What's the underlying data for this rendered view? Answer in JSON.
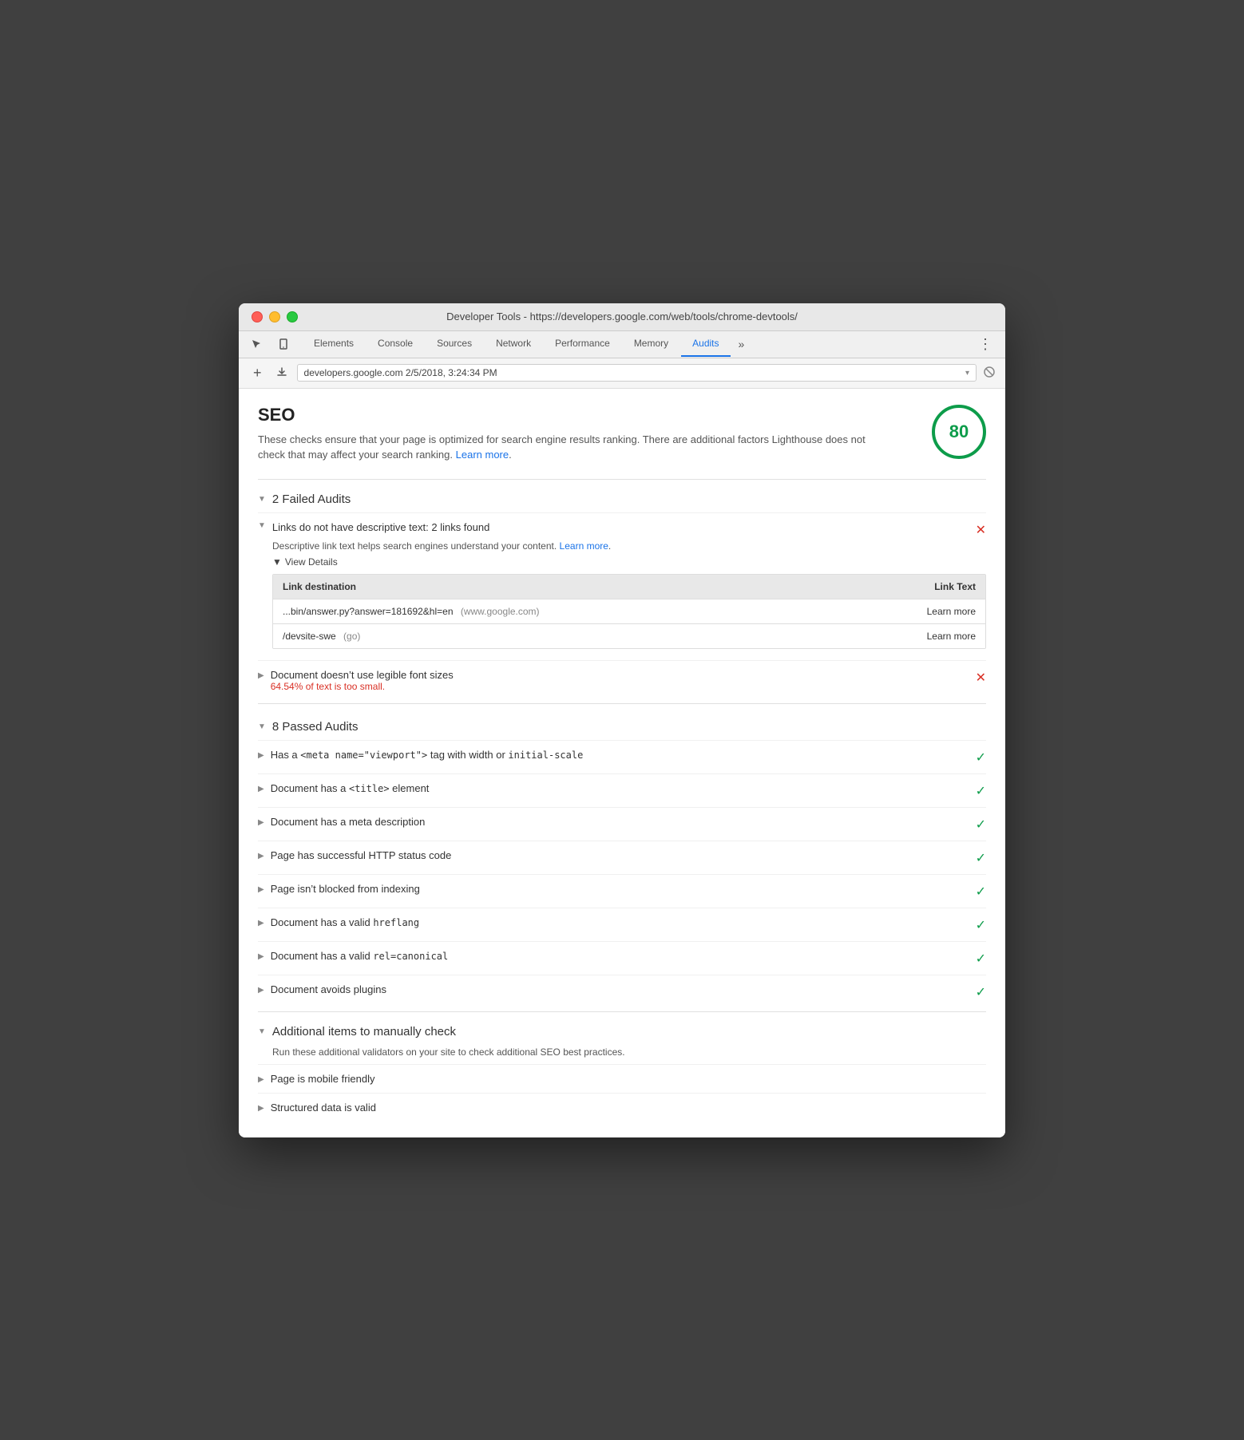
{
  "window": {
    "title": "Developer Tools - https://developers.google.com/web/tools/chrome-devtools/"
  },
  "titleBar": {
    "title": "Developer Tools - https://developers.google.com/web/tools/chrome-devtools/"
  },
  "tabs": [
    {
      "label": "Elements",
      "active": false
    },
    {
      "label": "Console",
      "active": false
    },
    {
      "label": "Sources",
      "active": false
    },
    {
      "label": "Network",
      "active": false
    },
    {
      "label": "Performance",
      "active": false
    },
    {
      "label": "Memory",
      "active": false
    },
    {
      "label": "Audits",
      "active": true
    }
  ],
  "addressBar": {
    "url": "developers.google.com  2/5/2018, 3:24:34 PM"
  },
  "seo": {
    "title": "SEO",
    "description": "These checks ensure that your page is optimized for search engine results ranking. There are additional factors Lighthouse does not check that may affect your search ranking.",
    "learnMoreText": "Learn more",
    "score": "80"
  },
  "failedAudits": {
    "title": "2 Failed Audits",
    "items": [
      {
        "title": "Links do not have descriptive text: 2 links found",
        "subtitle": "Descriptive link text helps search engines understand your content.",
        "subtitleLinkText": "Learn more",
        "expanded": true,
        "viewDetailsLabel": "View Details",
        "table": {
          "headers": [
            "Link destination",
            "Link Text"
          ],
          "rows": [
            {
              "destination": "...bin/answer.py?answer=181692&hl=en",
              "destinationSecondary": "(www.google.com)",
              "linkText": "Learn more"
            },
            {
              "destination": "/devsite-swe",
              "destinationSecondary": "(go)",
              "linkText": "Learn more"
            }
          ]
        }
      },
      {
        "title": "Document doesn’t use legible font sizes",
        "errorText": "64.54% of text is too small.",
        "expanded": false
      }
    ]
  },
  "passedAudits": {
    "title": "8 Passed Audits",
    "items": [
      {
        "title": "Has a ",
        "titleCode": "<meta name=\"viewport\">",
        "titleAfter": " tag with width or ",
        "titleCodeAfter": "initial-scale"
      },
      {
        "title": "Document has a ",
        "titleCode": "<title>",
        "titleAfter": " element"
      },
      {
        "title": "Document has a meta description"
      },
      {
        "title": "Page has successful HTTP status code"
      },
      {
        "title": "Page isn’t blocked from indexing"
      },
      {
        "title": "Document has a valid ",
        "titleCode": "hreflang"
      },
      {
        "title": "Document has a valid ",
        "titleCode": "rel=canonical"
      },
      {
        "title": "Document avoids plugins"
      }
    ]
  },
  "additionalItems": {
    "title": "Additional items to manually check",
    "description": "Run these additional validators on your site to check additional SEO best practices.",
    "items": [
      {
        "title": "Page is mobile friendly"
      },
      {
        "title": "Structured data is valid"
      }
    ]
  }
}
